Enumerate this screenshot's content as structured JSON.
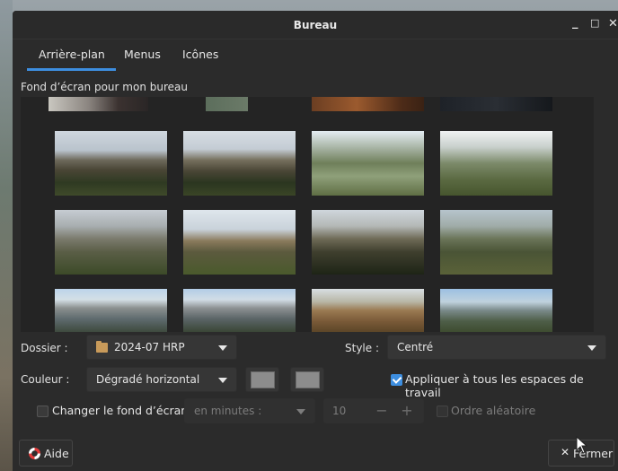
{
  "window": {
    "title": "Bureau",
    "controls": {
      "minimize": "_",
      "maximize": "□",
      "close": "✕"
    }
  },
  "tabs": [
    {
      "label": "Arrière-plan",
      "active": true
    },
    {
      "label": "Menus",
      "active": false
    },
    {
      "label": "Icônes",
      "active": false
    }
  ],
  "wallpaper": {
    "section_label": "Fond d’écran pour mon bureau"
  },
  "folder": {
    "label": "Dossier :",
    "value": "2024-07 HRP"
  },
  "style": {
    "label": "Style :",
    "value": "Centré"
  },
  "color": {
    "label": "Couleur :",
    "mode": "Dégradé horizontal"
  },
  "apply_all": {
    "label": "Appliquer à tous les espaces de travail",
    "checked": true
  },
  "change_wallpaper": {
    "label": "Changer le fond d’écran",
    "checked": false,
    "interval_unit": "en minutes :",
    "interval_value": "10",
    "minus": "−",
    "plus": "+"
  },
  "random_order": {
    "label": "Ordre aléatoire",
    "checked": false
  },
  "footer": {
    "help_label": "Aide",
    "close_label": "Fermer"
  },
  "colors": {
    "accent": "#3d8ee0",
    "window_bg": "#2b2b2b",
    "gallery_bg": "#242424"
  }
}
